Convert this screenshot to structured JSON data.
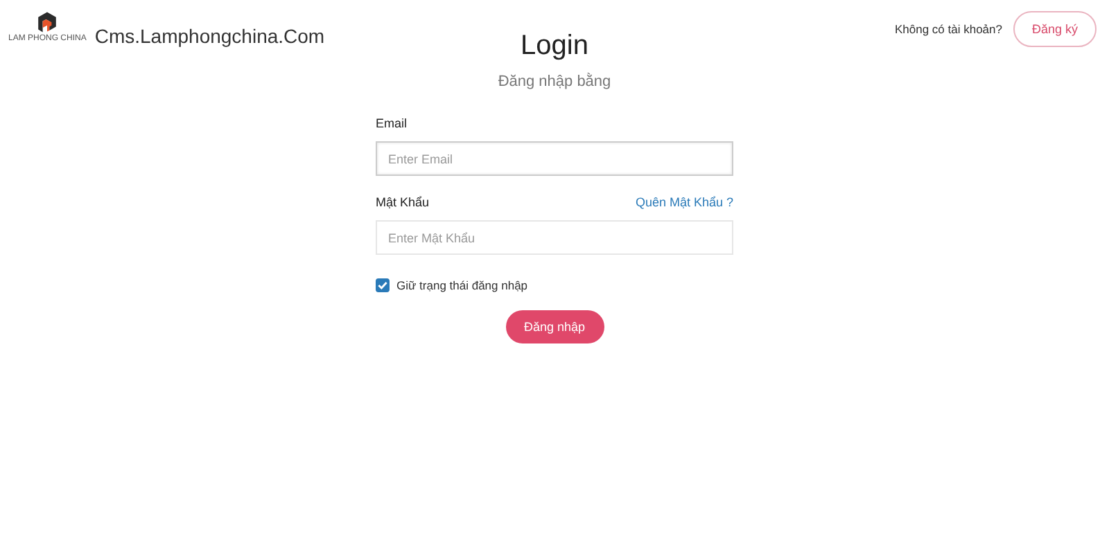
{
  "brand": {
    "logo_caption": "LAM PHONG CHINA",
    "site_name": "Cms.Lamphongchina.Com"
  },
  "signup": {
    "prompt": "Không có tài khoản?",
    "button": "Đăng ký"
  },
  "title": "Login",
  "subtitle": "Đăng nhập bằng",
  "fields": [
    {
      "label": "Email",
      "placeholder": "Enter Email",
      "focused": true
    },
    {
      "label": "Mật Khẩu",
      "placeholder": "Enter Mật Khẩu",
      "focused": false,
      "link": "Quên Mật Khẩu ?"
    }
  ],
  "remember": {
    "label": "Giữ trạng thái đăng nhập",
    "checked": true
  },
  "submit": "Đăng nhập"
}
